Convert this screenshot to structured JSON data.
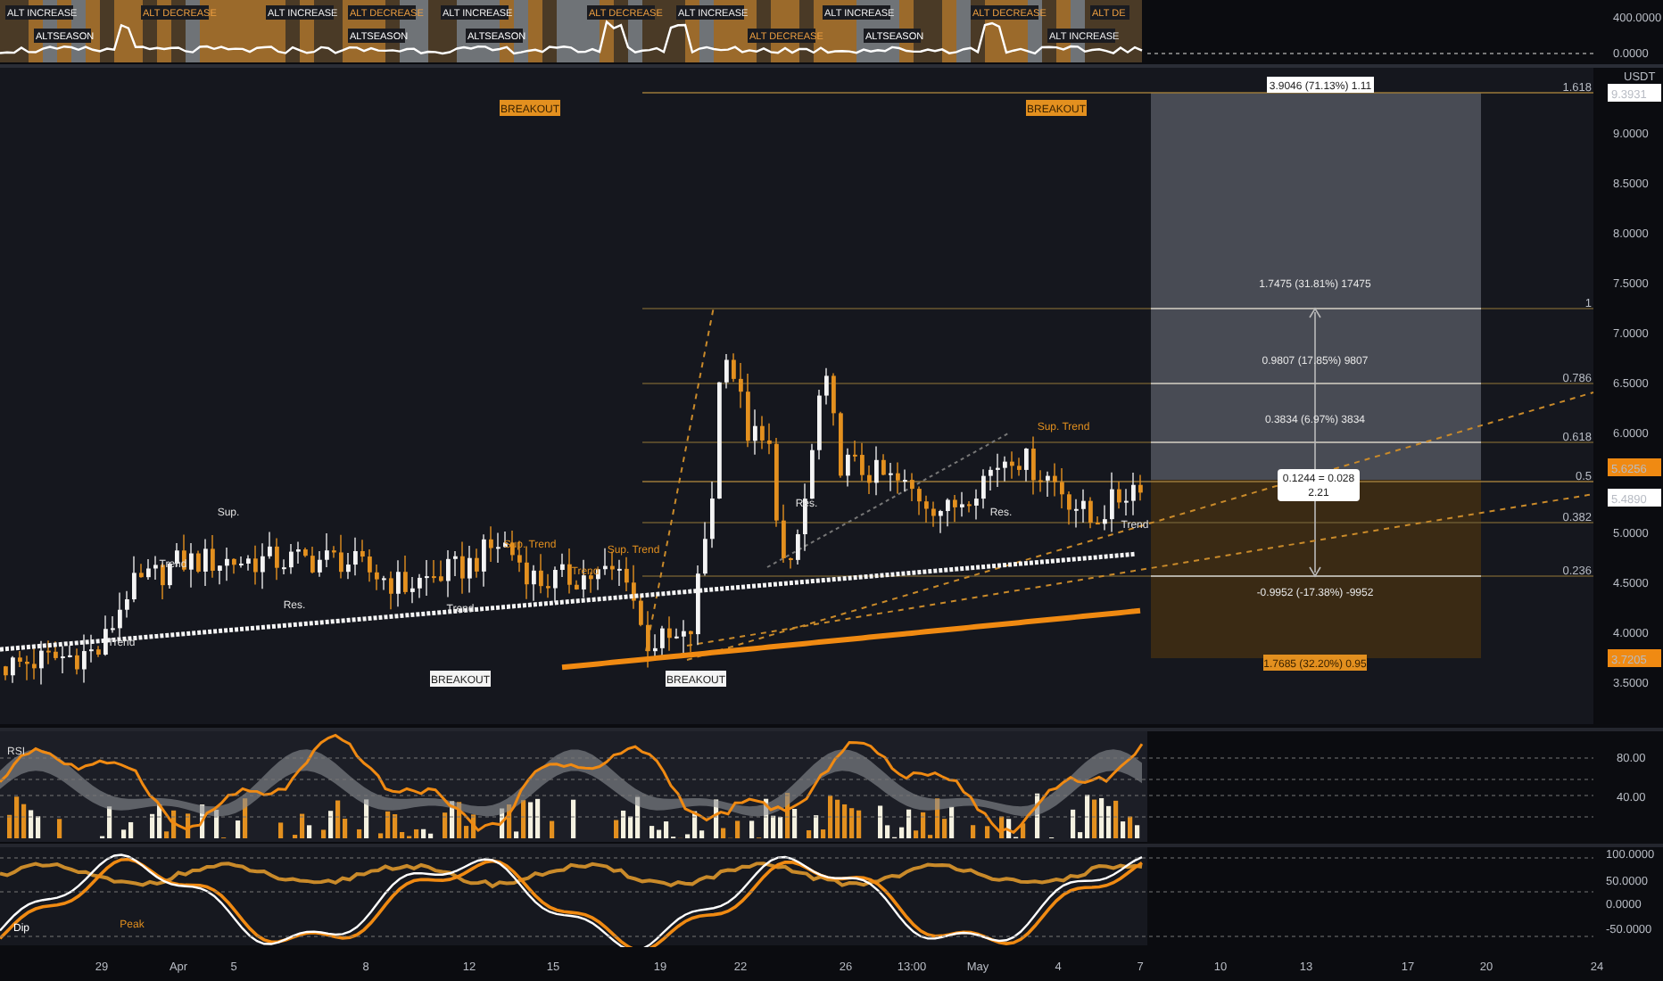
{
  "top_indicator": {
    "labels": [
      {
        "text": "ALT INCREASE",
        "kind": "increase"
      },
      {
        "text": "ALTSEASON",
        "kind": "season"
      },
      {
        "text": "ALT DECREASE",
        "kind": "decrease"
      },
      {
        "text": "ALT INCREASE",
        "kind": "increase"
      },
      {
        "text": "ALT DECREASE",
        "kind": "decrease"
      },
      {
        "text": "ALTSEASON",
        "kind": "season"
      },
      {
        "text": "ALT INCREASE",
        "kind": "increase"
      },
      {
        "text": "ALTSEASON",
        "kind": "season"
      },
      {
        "text": "ALT DECREASE",
        "kind": "decrease"
      },
      {
        "text": "ALT INCREASE",
        "kind": "increase"
      },
      {
        "text": "ALT DECREASE",
        "kind": "decrease"
      },
      {
        "text": "ALT INCREASE",
        "kind": "increase"
      },
      {
        "text": "ALTSEASON",
        "kind": "season"
      },
      {
        "text": "ALT DECREASE",
        "kind": "decrease"
      },
      {
        "text": "ALT INCREASE",
        "kind": "increase"
      },
      {
        "text": "ALT DE",
        "kind": "decrease"
      }
    ],
    "axis": [
      "400.0000",
      "0.0000"
    ]
  },
  "price_axis": {
    "currency": "USDT",
    "ticks": [
      "9.0000",
      "8.5000",
      "8.0000",
      "7.5000",
      "7.0000",
      "6.5000",
      "6.0000",
      "5.0000",
      "4.5000",
      "4.0000",
      "3.5000"
    ],
    "badges": [
      {
        "text": "9.3931",
        "kind": "plain"
      },
      {
        "text": "5.6256",
        "kind": "accent"
      },
      {
        "text": "5.4890",
        "kind": "plain"
      },
      {
        "text": "3.7205",
        "kind": "accent"
      }
    ]
  },
  "fib_levels": [
    "1.618",
    "1",
    "0.786",
    "0.618",
    "0.5",
    "0.382",
    "0.236"
  ],
  "measure": {
    "top": "3.9046 (71.13%) 1.11",
    "levels": [
      "1.7475 (31.81%) 17475",
      "0.9807 (17.85%) 9807",
      "0.3834 (6.97%) 3834"
    ],
    "center": [
      "0.1244 = 0.028",
      "2.21"
    ],
    "lower": "-0.9952 (-17.38%) -9952",
    "bottom": "1.7685 (32.20%) 0.95"
  },
  "chart_labels": [
    {
      "text": "BREAKOUT",
      "kind": "signal"
    },
    {
      "text": "BREAKOUT",
      "kind": "signal"
    },
    {
      "text": "BREAKOUT",
      "kind": "tag"
    },
    {
      "text": "BREAKOUT",
      "kind": "tag"
    },
    {
      "text": "Sup.",
      "kind": "note"
    },
    {
      "text": "Res.",
      "kind": "note"
    },
    {
      "text": "Trend",
      "kind": "note"
    },
    {
      "text": "Trend",
      "kind": "note"
    },
    {
      "text": "Trend",
      "kind": "note"
    },
    {
      "text": "Sup. Trend",
      "kind": "accent_note"
    },
    {
      "text": "Trend",
      "kind": "accent_note"
    },
    {
      "text": "Sup. Trend",
      "kind": "accent_note"
    },
    {
      "text": "Res.",
      "kind": "note"
    },
    {
      "text": "Res.",
      "kind": "note"
    },
    {
      "text": "Sup. Trend",
      "kind": "accent_note"
    },
    {
      "text": "Trend",
      "kind": "note"
    }
  ],
  "rsi_pane": {
    "title": "RSI",
    "ticks": [
      "80.00",
      "40.00"
    ]
  },
  "oscillator_pane": {
    "ticks": [
      "100.0000",
      "50.0000",
      "0.0000",
      "-50.0000"
    ],
    "markers": [
      {
        "text": "Dip",
        "kind": "dip"
      },
      {
        "text": "Peak",
        "kind": "peak"
      }
    ]
  },
  "time_axis": [
    "29",
    "Apr",
    "5",
    "8",
    "12",
    "15",
    "19",
    "22",
    "26",
    "13:00",
    "May",
    "4",
    "7",
    "10",
    "13",
    "17",
    "20",
    "24"
  ]
}
